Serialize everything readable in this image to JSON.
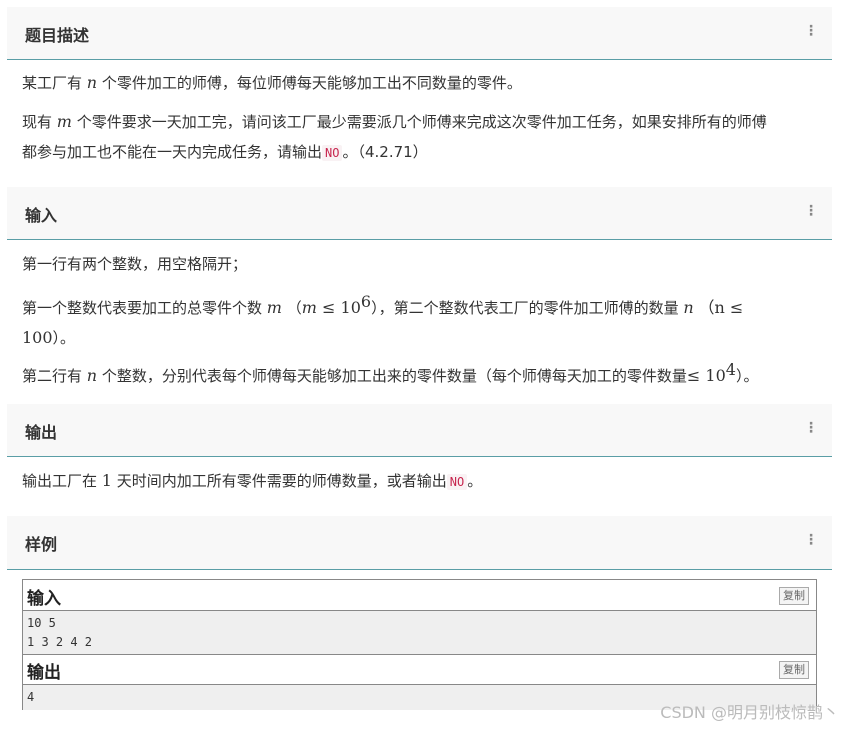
{
  "sections": {
    "description": {
      "title": "题目描述",
      "p1_a": "某工厂有",
      "p1_var": "n",
      "p1_b": "个零件加工的师傅，每位师傅每天能够加工出不同数量的零件。",
      "p2_a": "现有",
      "p2_var": "m",
      "p2_b": "个零件要求一天加工完，请问该工厂最少需要派几个师傅来完成这次零件加工任务，如果安排所有的师傅",
      "p2_c": "都参与加工也不能在一天内完成任务，请输出",
      "p2_code": "NO",
      "p2_d": "。（4.2.71）"
    },
    "input": {
      "title": "输入",
      "p1": "第一行有两个整数，用空格隔开；",
      "p2_a": "第一个整数代表要加工的总零件个数",
      "p2_m": "m",
      "p2_cond_open": "（",
      "p2_cond_m": "m",
      "p2_cond_le": " ≤ 10",
      "p2_cond_exp": "6",
      "p2_cond_close": "），第二个整数代表工厂的零件加工师傅的数量",
      "p2_n": "n",
      "p2_n_cond": "（n ≤",
      "p2_line2": "100",
      "p2_line2_end": "）。",
      "p3_a": "第二行有",
      "p3_n": "n",
      "p3_b": "个整数，分别代表每个师傅每天能够加工出来的零件数量（每个师傅每天加工的零件数量",
      "p3_le": "≤ 10",
      "p3_exp": "4",
      "p3_end": "）。"
    },
    "output": {
      "title": "输出",
      "p1_a": "输出工厂在",
      "p1_num": "1",
      "p1_b": "天时间内加工所有零件需要的师傅数量，或者输出",
      "p1_code": "NO",
      "p1_end": "。"
    },
    "sample": {
      "title": "样例",
      "input_label": "输入",
      "input_lines": [
        "10 5",
        "1 3 2 4 2"
      ],
      "output_label": "输出",
      "output_lines": [
        "4"
      ],
      "copy_label": "复制"
    }
  },
  "menu_icon": "vertical-dots-icon",
  "watermark": "CSDN @明月别枝惊鹊丶",
  "colors": {
    "header_bg": "#f8f8f8",
    "header_border": "#5a9ea6",
    "code_text": "#c7254e"
  }
}
